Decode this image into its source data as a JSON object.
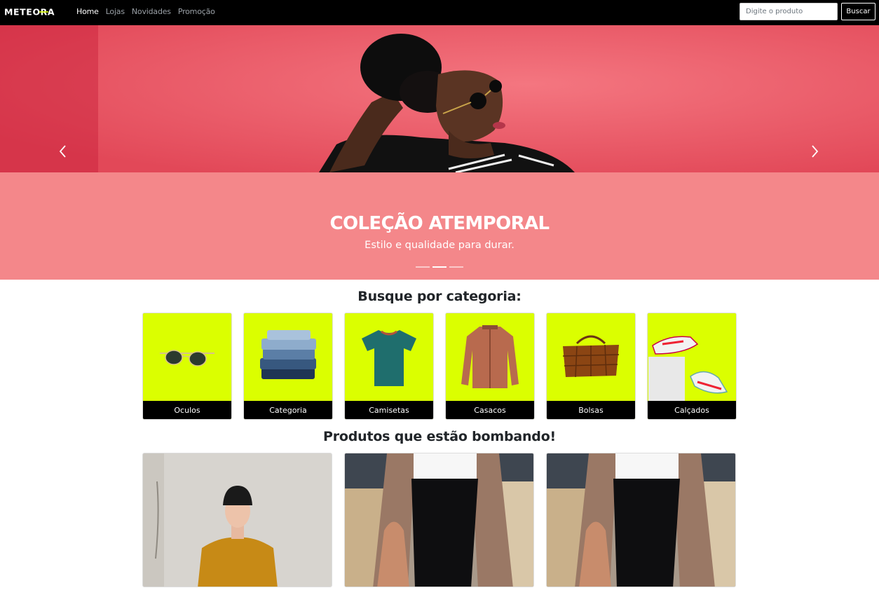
{
  "brand": "METEORA",
  "nav": {
    "links": [
      "Home",
      "Lojas",
      "Novidades",
      "Promoção"
    ]
  },
  "search": {
    "placeholder": "Digite o produto",
    "button": "Buscar"
  },
  "hero": {
    "title": "COLEÇÃO ATEMPORAL",
    "subtitle": "Estilo e qualidade para durar.",
    "slide_count": 3,
    "active_slide": 2,
    "prev_icon": "chevron-left-icon",
    "next_icon": "chevron-right-icon"
  },
  "categories": {
    "heading": "Busque por categoria:",
    "items": [
      "Oculos",
      "Categoria",
      "Camisetas",
      "Casacos",
      "Bolsas",
      "Calçados"
    ]
  },
  "products": {
    "heading": "Produtos que estão bombando!"
  },
  "colors": {
    "accent_green": "#dbff00",
    "hero_pink": "#f4878a",
    "navbar": "#000000"
  }
}
